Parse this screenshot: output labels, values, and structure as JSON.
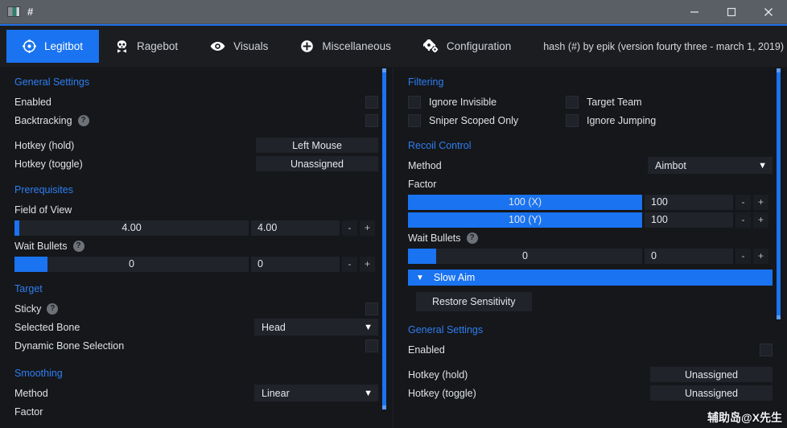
{
  "window": {
    "title": "#",
    "minimize_label": "Minimize",
    "maximize_label": "Maximize",
    "close_label": "Close"
  },
  "tabs": [
    {
      "label": "Legitbot",
      "icon": "crosshair-icon",
      "active": true
    },
    {
      "label": "Ragebot",
      "icon": "skull-icon",
      "active": false
    },
    {
      "label": "Visuals",
      "icon": "eye-icon",
      "active": false
    },
    {
      "label": "Miscellaneous",
      "icon": "plus-circle-icon",
      "active": false
    },
    {
      "label": "Configuration",
      "icon": "gears-icon",
      "active": false
    }
  ],
  "version_text": "hash (#) by epik (version fourty three - march 1, 2019)",
  "left_panel": {
    "general_settings": {
      "title": "General Settings",
      "enabled_label": "Enabled",
      "enabled_checked": false,
      "backtracking_label": "Backtracking",
      "backtracking_checked": false,
      "help_glyph": "?",
      "hotkey_hold_label": "Hotkey (hold)",
      "hotkey_hold_value": "Left Mouse",
      "hotkey_toggle_label": "Hotkey (toggle)",
      "hotkey_toggle_value": "Unassigned"
    },
    "prerequisites": {
      "title": "Prerequisites",
      "fov_label": "Field of View",
      "fov_slider_value": "4.00",
      "fov_box_value": "4.00",
      "fov_fill_percent": 2,
      "wait_bullets_label": "Wait Bullets",
      "wait_bullets_slider_value": "0",
      "wait_bullets_box_value": "0",
      "wait_bullets_fill_percent": 14,
      "minus_label": "-",
      "plus_label": "+"
    },
    "target": {
      "title": "Target",
      "sticky_label": "Sticky",
      "sticky_checked": false,
      "selected_bone_label": "Selected Bone",
      "selected_bone_value": "Head",
      "dynamic_bone_label": "Dynamic Bone Selection",
      "dynamic_bone_checked": false
    },
    "smoothing": {
      "title": "Smoothing",
      "method_label": "Method",
      "method_value": "Linear",
      "factor_label": "Factor"
    }
  },
  "right_panel": {
    "filtering": {
      "title": "Filtering",
      "items": [
        {
          "label": "Ignore Invisible",
          "checked": false
        },
        {
          "label": "Target Team",
          "checked": false
        },
        {
          "label": "Sniper Scoped Only",
          "checked": false
        },
        {
          "label": "Ignore Jumping",
          "checked": false
        }
      ]
    },
    "recoil_control": {
      "title": "Recoil Control",
      "method_label": "Method",
      "method_value": "Aimbot",
      "factor_label": "Factor",
      "x_slider_value": "100 (X)",
      "x_box_value": "100",
      "x_fill_percent": 100,
      "y_slider_value": "100 (Y)",
      "y_box_value": "100",
      "y_fill_percent": 100,
      "wait_bullets_label": "Wait Bullets",
      "wait_bullets_slider_value": "0",
      "wait_bullets_box_value": "0",
      "wait_bullets_fill_percent": 12,
      "minus_label": "-",
      "plus_label": "+"
    },
    "slow_aim": {
      "header_label": "Slow Aim",
      "collapsed_caret": "▼",
      "restore_sensitivity_label": "Restore Sensitivity"
    },
    "general_settings": {
      "title": "General Settings",
      "enabled_label": "Enabled",
      "enabled_checked": false,
      "hotkey_hold_label": "Hotkey (hold)",
      "hotkey_hold_value": "Unassigned",
      "hotkey_toggle_label": "Hotkey (toggle)",
      "hotkey_toggle_value": "Unassigned"
    }
  },
  "watermark": "辅助岛@X先生",
  "colors": {
    "accent": "#1a73f0",
    "group_title": "#2f7ef0",
    "panel_bg": "#15171b",
    "field_bg": "#202329",
    "titlebar_bg": "#5a5f66"
  }
}
